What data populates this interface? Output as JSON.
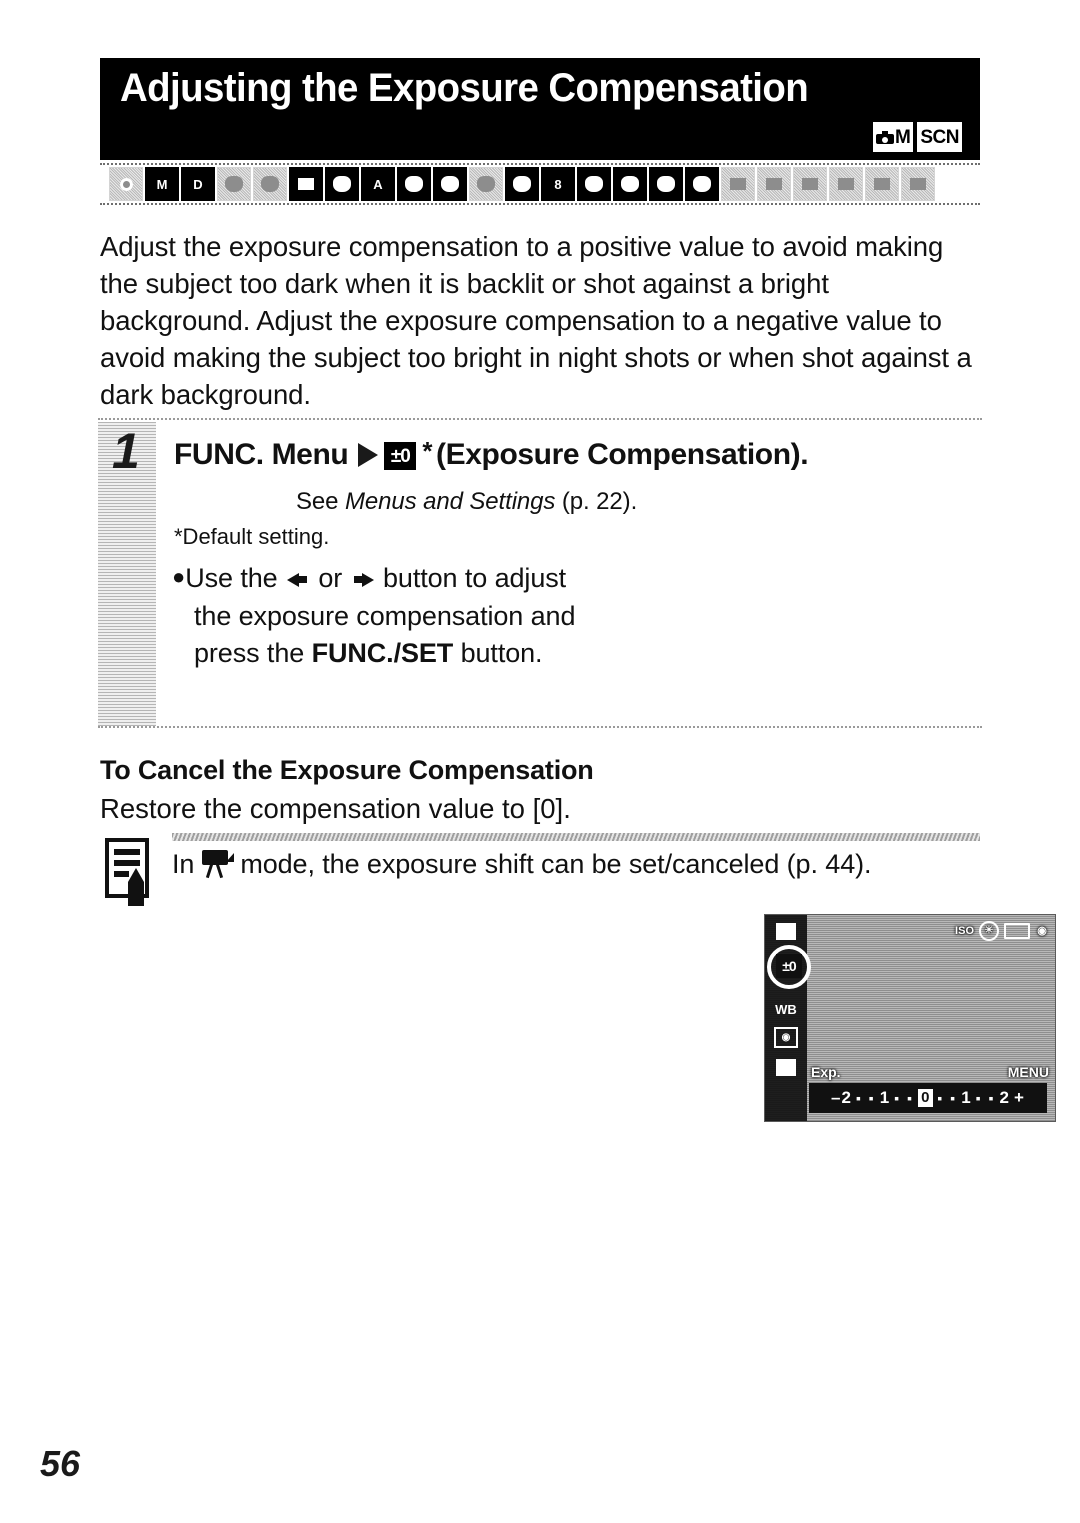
{
  "header": {
    "title": "Adjusting the Exposure Compensation",
    "mode_badges": [
      {
        "name": "camera-m-badge",
        "label": "M"
      },
      {
        "name": "scn-badge",
        "label": "SCN"
      }
    ]
  },
  "mode_strip": {
    "icons": [
      {
        "name": "auto-mode-icon",
        "glyph": "dot",
        "active": false
      },
      {
        "name": "manual-mode-icon",
        "glyph": "M",
        "active": true
      },
      {
        "name": "digital-macro-icon",
        "glyph": "D",
        "active": true
      },
      {
        "name": "color-accent-icon",
        "glyph": "blob",
        "active": false
      },
      {
        "name": "color-swap-icon",
        "glyph": "blob",
        "active": false
      },
      {
        "name": "stitch-assist-icon",
        "glyph": "sq",
        "active": true
      },
      {
        "name": "portrait-icon",
        "glyph": "blob",
        "active": true
      },
      {
        "name": "night-snapshot-icon",
        "glyph": "A",
        "active": true
      },
      {
        "name": "kids-and-pets-icon",
        "glyph": "blob",
        "active": true
      },
      {
        "name": "indoor-icon",
        "glyph": "blob",
        "active": true
      },
      {
        "name": "foliage-icon",
        "glyph": "blob",
        "active": false
      },
      {
        "name": "leaf-icon",
        "glyph": "blob",
        "active": true
      },
      {
        "name": "snow-icon",
        "glyph": "8",
        "active": true
      },
      {
        "name": "beach-icon",
        "glyph": "blob",
        "active": true
      },
      {
        "name": "fireworks-icon",
        "glyph": "blob",
        "active": true
      },
      {
        "name": "aquarium-icon",
        "glyph": "blob",
        "active": true
      },
      {
        "name": "underwater-icon",
        "glyph": "blob",
        "active": true
      },
      {
        "name": "movie-standard-icon",
        "glyph": "sq",
        "active": false
      },
      {
        "name": "movie-compact-icon",
        "glyph": "sq",
        "active": false
      },
      {
        "name": "movie-color-accent-icon",
        "glyph": "sq",
        "active": false
      },
      {
        "name": "movie-color-swap-icon",
        "glyph": "sq",
        "active": false
      },
      {
        "name": "playback-icon",
        "glyph": "sq",
        "active": false
      },
      {
        "name": "print-icon",
        "glyph": "sq",
        "active": false
      }
    ]
  },
  "intro": {
    "paragraph": "Adjust the exposure compensation to a positive value to avoid making the subject too dark when it is backlit or shot against a bright background. Adjust the exposure compensation to a negative value to avoid making the subject too bright in night shots or when shot against a dark background."
  },
  "step": {
    "number": "1",
    "heading_prefix": "FUNC. Menu",
    "heading_icon_label": "±0",
    "heading_suffix": "(Exposure Compensation).",
    "see_prefix": "See",
    "see_italic": "Menus and Settings",
    "see_suffix": "(p. 22).",
    "default_note": "*Default setting.",
    "bullet_line1_a": "Use the",
    "bullet_line1_b": "or",
    "bullet_line1_c": "button to adjust",
    "bullet_line2": "the exposure compensation and",
    "bullet_line3_a": "press the",
    "bullet_line3_b": "FUNC./SET",
    "bullet_line3_c": "button."
  },
  "lcd": {
    "ec_chip_label": "±0",
    "status_icons": [
      {
        "name": "iso-indicator",
        "label": "ISO"
      },
      {
        "name": "flash-off-indicator",
        "label": "✳"
      },
      {
        "name": "battery-indicator",
        "label": ""
      },
      {
        "name": "camera-indicator",
        "label": "◉"
      }
    ],
    "rail_icons": [
      {
        "name": "white-balance-icon",
        "label": "WB"
      },
      {
        "name": "photo-effect-icon",
        "label": "◉"
      },
      {
        "name": "iso-speed-icon",
        "label": ""
      }
    ],
    "label_left": "Exp.",
    "label_right": "MENU",
    "scale": {
      "minus_end": "–2",
      "minus_mid": "1",
      "zero": "0",
      "plus_mid": "1",
      "plus_end": "2",
      "plus_sign": "+",
      "dots": "▪ ▪"
    }
  },
  "cancel": {
    "heading": "To Cancel the Exposure Compensation",
    "body": "Restore the compensation value to [0]."
  },
  "note": {
    "icon_name": "memo-note-icon",
    "text_before": "In",
    "mode_icon_name": "movie-mode-icon",
    "text_after": "mode, the exposure shift can be set/canceled (p. 44)."
  },
  "footer": {
    "page_number": "56"
  }
}
